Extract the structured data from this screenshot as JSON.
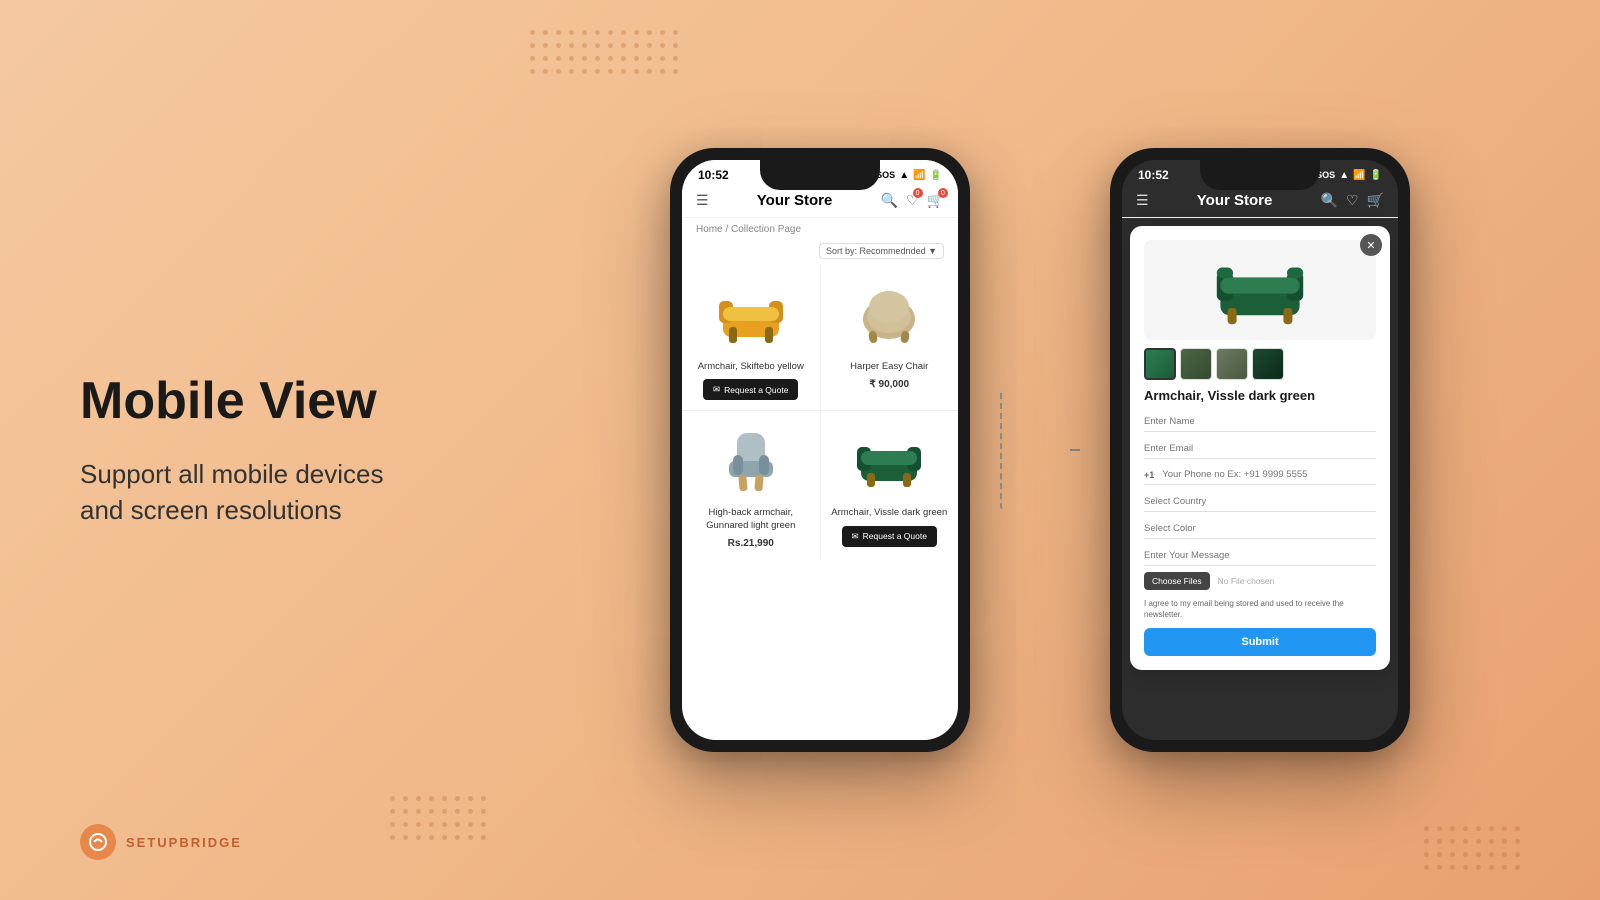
{
  "left": {
    "main_title": "Mobile View",
    "sub_title": "Support all mobile devices\nand screen resolutions",
    "brand_name": "SETUPBRIDGE"
  },
  "phone1": {
    "status_bar": {
      "time": "10:52",
      "sos": "SOS",
      "signal": "▲",
      "battery": "■"
    },
    "header": {
      "title": "Your Store"
    },
    "breadcrumb": "Home / Collection Page",
    "sort_label": "Sort by: Recommednded",
    "products": [
      {
        "name": "Armchair, Skiftebo yellow",
        "price": "",
        "btn": "Request a Quote",
        "color": "yellow"
      },
      {
        "name": "Harper Easy Chair",
        "price": "₹ 90,000",
        "btn": "",
        "color": "beige"
      },
      {
        "name": "High-back armchair, Gunnared light green",
        "price": "Rs.21,990",
        "btn": "",
        "color": "gray"
      },
      {
        "name": "Armchair, Vissle dark green",
        "price": "",
        "btn": "Request a Quote",
        "color": "green"
      }
    ]
  },
  "phone2": {
    "status_bar": {
      "time": "10:52",
      "sos": "SOS"
    },
    "header": {
      "title": "Your Store"
    },
    "modal": {
      "product_name": "Armchair, Vissle dark green",
      "fields": {
        "name_placeholder": "Enter Name",
        "email_placeholder": "Enter Email",
        "phone_placeholder": "Your Phone no Ex: +91 9999 5555",
        "country_code": "+1",
        "country_placeholder": "Select Country",
        "color_placeholder": "Select Color",
        "message_placeholder": "Enter Your Message",
        "file_btn": "Choose Files",
        "file_label": "No File chosen",
        "consent_text": "I agree to my email being stored and used to receive the newsletter.",
        "submit_btn": "Submit"
      }
    }
  }
}
